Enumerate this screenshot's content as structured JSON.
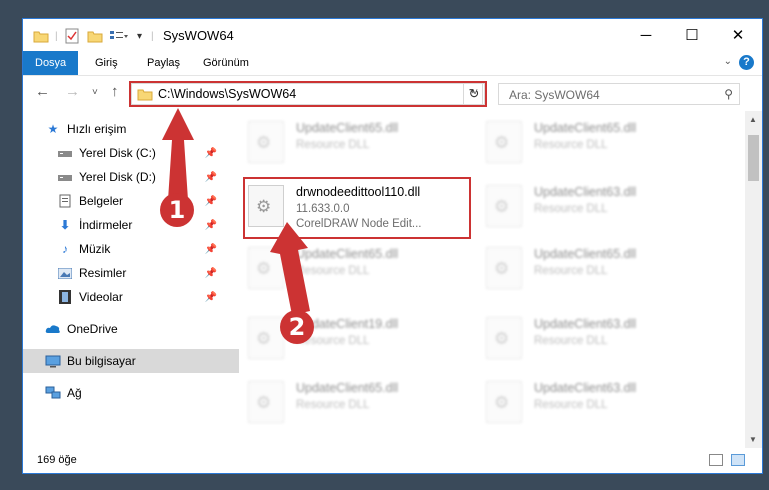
{
  "window": {
    "title": "SysWOW64"
  },
  "ribbon": {
    "tabs": [
      "Dosya",
      "Giriş",
      "Paylaş",
      "Görünüm"
    ],
    "help_label": "?"
  },
  "navigation": {
    "address": "C:\\Windows\\SysWOW64",
    "search_placeholder": "Ara: SysWOW64"
  },
  "sidebar": {
    "quick_access": "Hızlı erişim",
    "items": [
      {
        "label": "Yerel Disk (C:)",
        "icon": "drive-icon"
      },
      {
        "label": "Yerel Disk (D:)",
        "icon": "drive-icon"
      },
      {
        "label": "Belgeler",
        "icon": "documents-icon"
      },
      {
        "label": "İndirmeler",
        "icon": "downloads-icon"
      },
      {
        "label": "Müzik",
        "icon": "music-icon"
      },
      {
        "label": "Resimler",
        "icon": "pictures-icon"
      },
      {
        "label": "Videolar",
        "icon": "videos-icon"
      }
    ],
    "onedrive": "OneDrive",
    "this_pc": "Bu bilgisayar",
    "network": "Ağ"
  },
  "files": {
    "highlighted": {
      "name": "drwnodeedittool110.dll",
      "version": "11.633.0.0",
      "description": "CorelDRAW Node Edit..."
    },
    "background": [
      {
        "name": "UpdateClient65.dll",
        "description": "Resource DLL"
      },
      {
        "name": "UpdateClient65.dll",
        "description": "Resource DLL"
      },
      {
        "name": "UpdateClient63.dll",
        "description": "Resource DLL"
      },
      {
        "name": "UpdateClient65.dll",
        "description": "Resource DLL"
      },
      {
        "name": "UpdateClient65.dll",
        "description": "Resource DLL"
      },
      {
        "name": "UpdateClient19.dll",
        "description": "Resource DLL"
      },
      {
        "name": "UpdateClient63.dll",
        "description": "Resource DLL"
      },
      {
        "name": "UpdateClient65.dll",
        "description": "Resource DLL"
      },
      {
        "name": "UpdateClient63.dll",
        "description": "Resource DLL"
      }
    ]
  },
  "status": {
    "item_count": "169 öğe"
  },
  "annotations": {
    "step1": "1",
    "step2": "2"
  },
  "colors": {
    "accent": "#1979ca",
    "highlight": "#cc3333",
    "selected": "#d9d9d9"
  }
}
